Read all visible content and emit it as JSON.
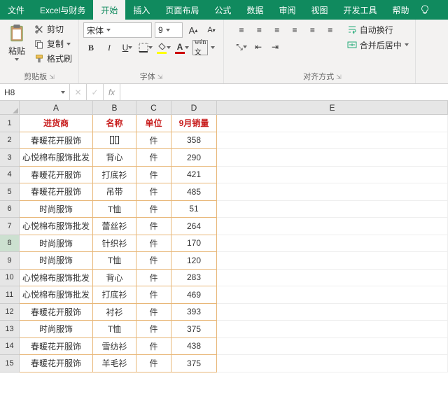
{
  "tabs": [
    "文件",
    "Excel与财务",
    "开始",
    "插入",
    "页面布局",
    "公式",
    "数据",
    "审阅",
    "视图",
    "开发工具",
    "帮助"
  ],
  "active_tab": 2,
  "ribbon": {
    "clipboard": {
      "label": "剪贴板",
      "paste": "粘贴",
      "cut": "剪切",
      "copy": "复制",
      "format_painter": "格式刷"
    },
    "font": {
      "label": "字体",
      "name": "宋体",
      "size": "9",
      "bold": "B",
      "italic": "I",
      "underline": "U",
      "yellow": "#ffff00",
      "red": "#cc0000"
    },
    "align": {
      "label": "对齐方式",
      "wrap": "自动换行",
      "merge": "合并后居中"
    }
  },
  "namebox": "H8",
  "fx": "fx",
  "columns": [
    "A",
    "B",
    "C",
    "D",
    "E"
  ],
  "headers": {
    "A": "进货商",
    "B": "名称",
    "C": "单位",
    "D": "9月销量"
  },
  "rows": [
    {
      "n": 2,
      "A": "春暖花开服饰",
      "B": "",
      "C": "件",
      "D": "358",
      "cursor": true
    },
    {
      "n": 3,
      "A": "心悦棉布服饰批发",
      "B": "背心",
      "C": "件",
      "D": "290"
    },
    {
      "n": 4,
      "A": "春暖花开服饰",
      "B": "打底衫",
      "C": "件",
      "D": "421"
    },
    {
      "n": 5,
      "A": "春暖花开服饰",
      "B": "吊带",
      "C": "件",
      "D": "485"
    },
    {
      "n": 6,
      "A": "时尚服饰",
      "B": "T恤",
      "C": "件",
      "D": "51"
    },
    {
      "n": 7,
      "A": "心悦棉布服饰批发",
      "B": "蕾丝衫",
      "C": "件",
      "D": "264"
    },
    {
      "n": 8,
      "A": "时尚服饰",
      "B": "针织衫",
      "C": "件",
      "D": "170"
    },
    {
      "n": 9,
      "A": "时尚服饰",
      "B": "T恤",
      "C": "件",
      "D": "120"
    },
    {
      "n": 10,
      "A": "心悦棉布服饰批发",
      "B": "背心",
      "C": "件",
      "D": "283"
    },
    {
      "n": 11,
      "A": "心悦棉布服饰批发",
      "B": "打底衫",
      "C": "件",
      "D": "469"
    },
    {
      "n": 12,
      "A": "春暖花开服饰",
      "B": "衬衫",
      "C": "件",
      "D": "393"
    },
    {
      "n": 13,
      "A": "时尚服饰",
      "B": "T恤",
      "C": "件",
      "D": "375"
    },
    {
      "n": 14,
      "A": "春暖花开服饰",
      "B": "雪纺衫",
      "C": "件",
      "D": "438"
    },
    {
      "n": 15,
      "A": "春暖花开服饰",
      "B": "羊毛衫",
      "C": "件",
      "D": "375"
    }
  ],
  "active_row": 8
}
